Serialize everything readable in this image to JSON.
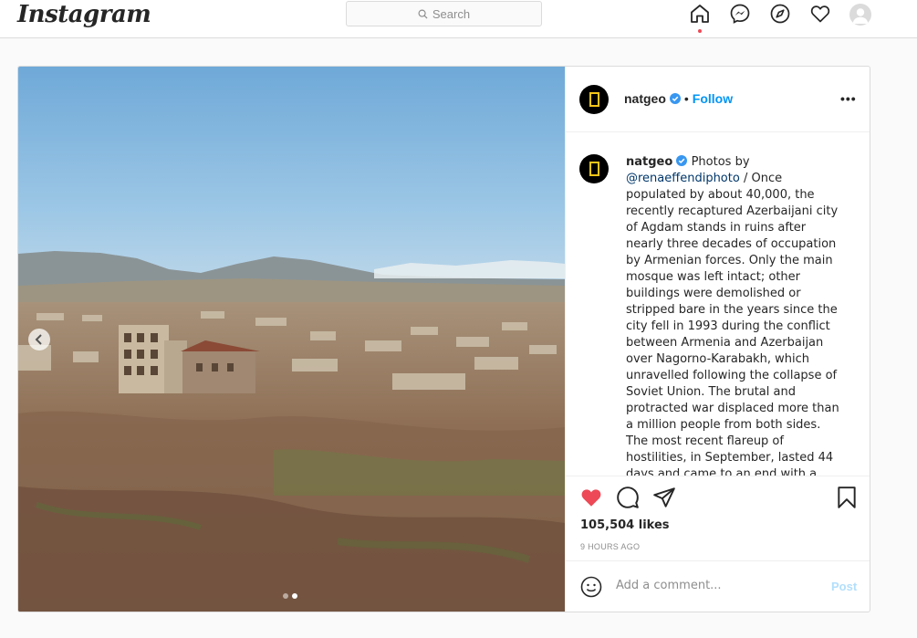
{
  "nav": {
    "logo": "Instagram",
    "search_placeholder": "Search",
    "icons": [
      "home-icon",
      "messenger-icon",
      "explore-icon",
      "activity-heart-icon",
      "profile-avatar"
    ]
  },
  "post": {
    "username": "natgeo",
    "follow_label": "Follow",
    "more_label": "•••",
    "caption": {
      "username": "natgeo",
      "lead": "Photos by",
      "mention": "@renaeffendiphoto",
      "body": " / Once populated by about 40,000, the recently recaptured Azerbaijani city of Agdam stands in ruins after nearly three decades of occupation by Armenian forces. Only the main mosque was left intact; other buildings were demolished or stripped bare in the years since the city fell in 1993 during the conflict between Armenia and Azerbaijan over Nagorno-Karabakh, which unravelled following the collapse of Soviet Union. The brutal and protracted war displaced more than a million people from both sides. The most recent flareup of hostilities, in September, lasted 44 days and came to an end with a peace deal brokered by Russia, which resulted in"
    },
    "likes": "105,504 likes",
    "timestamp": "9 HOURS AGO",
    "comment_placeholder": "Add a comment...",
    "post_label": "Post",
    "liked": true,
    "carousel": {
      "count": 2,
      "active_index": 1
    }
  },
  "colors": {
    "like_red": "#ed4956",
    "link_blue": "#0095f6",
    "verified_blue": "#3897f0",
    "natgeo_yellow": "#f5c518"
  }
}
